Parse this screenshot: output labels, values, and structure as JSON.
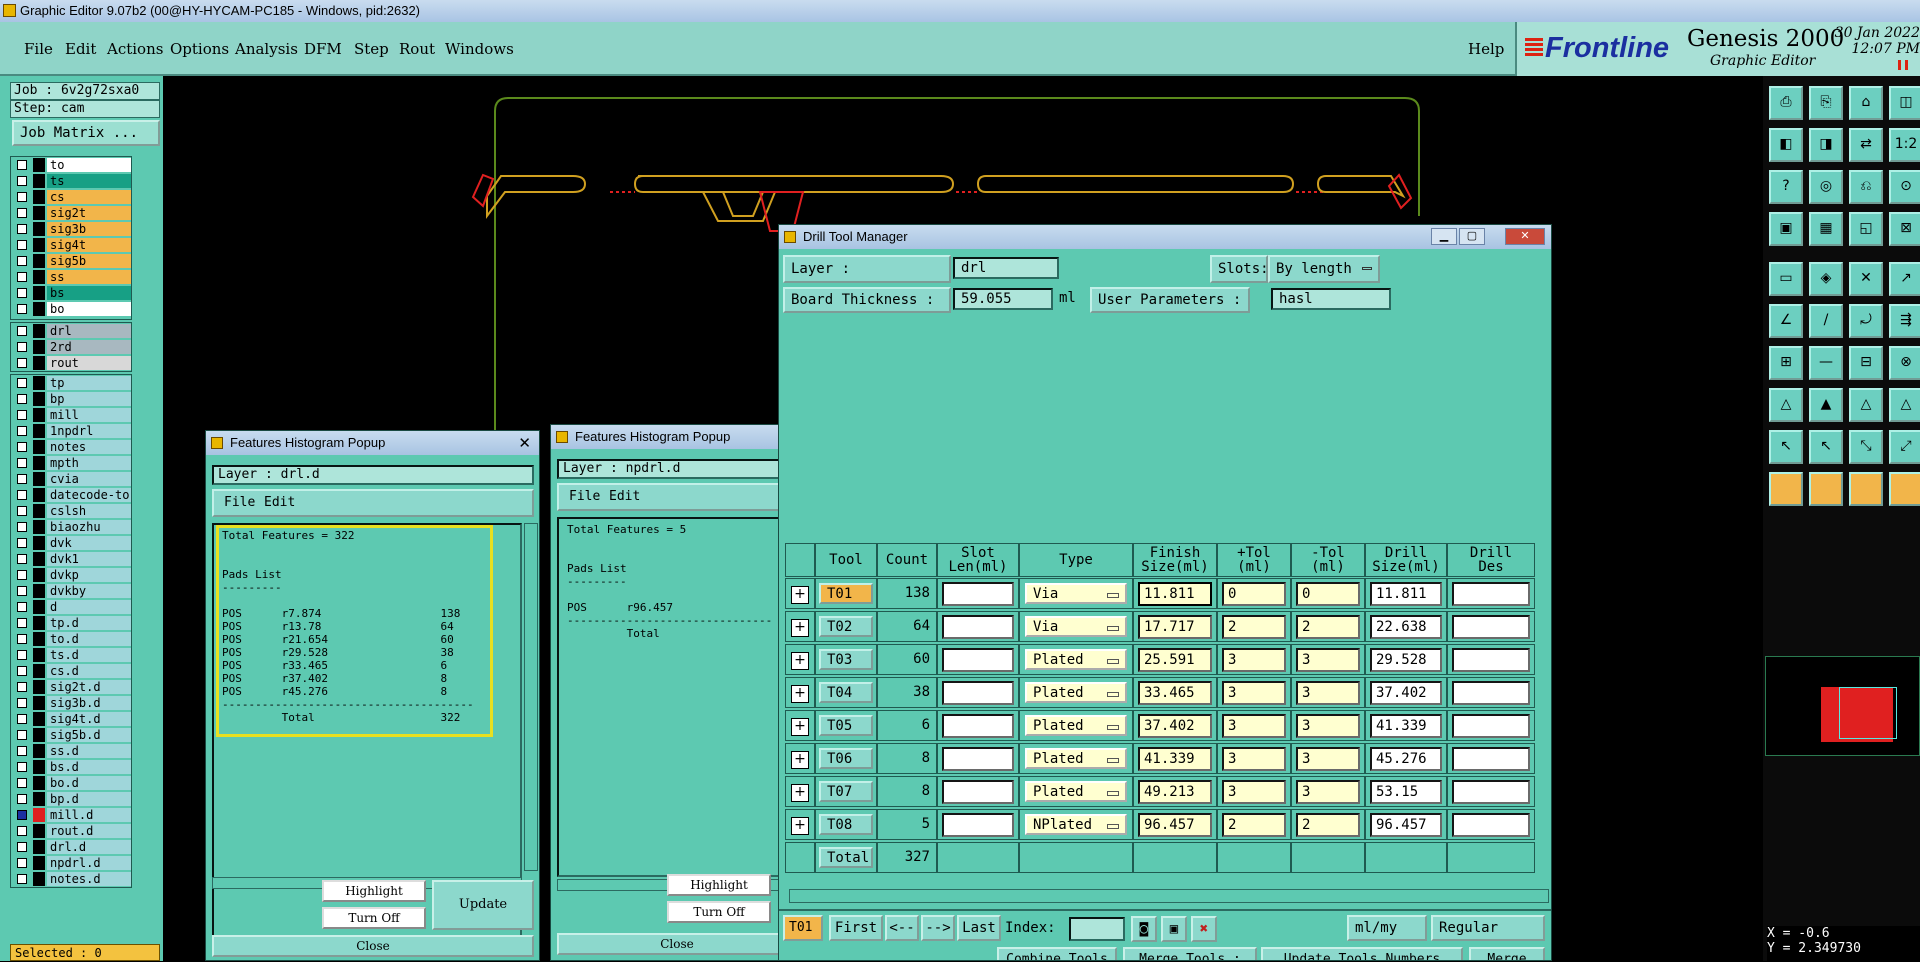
{
  "app": {
    "title": "Graphic Editor 9.07b2 (00@HY-HYCAM-PC185 - Windows, pid:2632)"
  },
  "menu": {
    "items": [
      "File",
      "Edit",
      "Actions",
      "Options",
      "Analysis",
      "DFM",
      "Step",
      "Rout",
      "Windows"
    ],
    "help": "Help"
  },
  "brand": {
    "logo": "Frontline",
    "product": "Genesis 2000",
    "subtitle": "Graphic Editor",
    "date": "30 Jan 2022",
    "time": "12:07 PM"
  },
  "left": {
    "job": "Job : 6v2g72sxa0",
    "step": "Step: cam",
    "job_matrix": "Job Matrix ...",
    "selected": "Selected : 0",
    "layers_a": [
      {
        "name": "to",
        "color": "#ffffff"
      },
      {
        "name": "ts",
        "color": "#17a085"
      },
      {
        "name": "cs",
        "color": "#f2b54a"
      },
      {
        "name": "sig2t",
        "color": "#f2b54a"
      },
      {
        "name": "sig3b",
        "color": "#f2b54a"
      },
      {
        "name": "sig4t",
        "color": "#f2b54a"
      },
      {
        "name": "sig5b",
        "color": "#f2b54a"
      },
      {
        "name": "ss",
        "color": "#f2b54a"
      },
      {
        "name": "bs",
        "color": "#17a085"
      },
      {
        "name": "bo",
        "color": "#ffffff"
      }
    ],
    "layers_b": [
      {
        "name": "drl",
        "color": "#a8b8c0"
      },
      {
        "name": "2rd",
        "color": "#a8b8c0"
      },
      {
        "name": "rout",
        "color": "#d8d8d8"
      }
    ],
    "layers_c": [
      {
        "name": "tp",
        "color": "#9fd6da"
      },
      {
        "name": "bp",
        "color": "#9fd6da"
      },
      {
        "name": "mill",
        "color": "#9fd6da"
      },
      {
        "name": "1npdrl",
        "color": "#9fd6da"
      },
      {
        "name": "notes",
        "color": "#9fd6da"
      },
      {
        "name": "mpth",
        "color": "#9fd6da"
      },
      {
        "name": "cvia",
        "color": "#9fd6da"
      },
      {
        "name": "datecode-to",
        "color": "#9fd6da"
      },
      {
        "name": "cslsh",
        "color": "#9fd6da"
      },
      {
        "name": "biaozhu",
        "color": "#9fd6da"
      },
      {
        "name": "dvk",
        "color": "#9fd6da"
      },
      {
        "name": "dvk1",
        "color": "#9fd6da"
      },
      {
        "name": "dvkp",
        "color": "#9fd6da"
      },
      {
        "name": "dvkby",
        "color": "#9fd6da"
      },
      {
        "name": "d",
        "color": "#9fd6da"
      },
      {
        "name": "tp.d",
        "color": "#9fd6da"
      },
      {
        "name": "to.d",
        "color": "#9fd6da"
      },
      {
        "name": "ts.d",
        "color": "#9fd6da"
      },
      {
        "name": "cs.d",
        "color": "#9fd6da"
      },
      {
        "name": "sig2t.d",
        "color": "#9fd6da"
      },
      {
        "name": "sig3b.d",
        "color": "#9fd6da"
      },
      {
        "name": "sig4t.d",
        "color": "#9fd6da"
      },
      {
        "name": "sig5b.d",
        "color": "#9fd6da"
      },
      {
        "name": "ss.d",
        "color": "#9fd6da"
      },
      {
        "name": "bs.d",
        "color": "#9fd6da"
      },
      {
        "name": "bo.d",
        "color": "#9fd6da"
      },
      {
        "name": "bp.d",
        "color": "#9fd6da"
      },
      {
        "name": "mill.d",
        "color": "#9fd6da"
      },
      {
        "name": "rout.d",
        "color": "#9fd6da"
      },
      {
        "name": "drl.d",
        "color": "#9fd6da"
      },
      {
        "name": "npdrl.d",
        "color": "#9fd6da"
      },
      {
        "name": "notes.d",
        "color": "#9fd6da"
      }
    ]
  },
  "hist1": {
    "title": "Features Histogram Popup",
    "layer": "Layer :  drl.d",
    "menu": [
      "File",
      "Edit"
    ],
    "text": "Total Features = 322\n\n\nPads List\n---------\n\nPOS      r7.874                  138\nPOS      r13.78                  64\nPOS      r21.654                 60\nPOS      r29.528                 38\nPOS      r33.465                 6\nPOS      r37.402                 8\nPOS      r45.276                 8\n--------------------------------------\n         Total                   322",
    "highlight": "Highlight",
    "turn_off": "Turn Off",
    "update": "Update",
    "close": "Close"
  },
  "hist2": {
    "title": "Features Histogram Popup",
    "layer": "Layer :  npdrl.d",
    "menu": [
      "File",
      "Edit"
    ],
    "text": "Total Features = 5\n\n\nPads List\n---------\n\nPOS      r96.457\n-------------------------------\n         Total",
    "highlight": "Highlight",
    "turn_off": "Turn Off",
    "close": "Close"
  },
  "dtm": {
    "title": "Drill Tool Manager",
    "layer_label": "Layer          :",
    "layer": "drl",
    "slots_label": "Slots:",
    "slots": "By length",
    "thickness_label": "Board Thickness :",
    "thickness": "59.055",
    "thickness_unit": "ml",
    "user_params_label": "User Parameters :",
    "user_params": "hasl",
    "headers": [
      "Tool",
      "Count",
      "Slot\nLen(ml)",
      "Type",
      "Finish\nSize(ml)",
      "+Tol\n(ml)",
      "-Tol\n(ml)",
      "Drill\nSize(ml)",
      "Drill\nDes"
    ],
    "rows": [
      {
        "tool": "T01",
        "count": "138",
        "type": "Via",
        "finish": "11.811",
        "ptol": "0",
        "mtol": "0",
        "drill": "11.811"
      },
      {
        "tool": "T02",
        "count": "64",
        "type": "Via",
        "finish": "17.717",
        "ptol": "2",
        "mtol": "2",
        "drill": "22.638"
      },
      {
        "tool": "T03",
        "count": "60",
        "type": "Plated",
        "finish": "25.591",
        "ptol": "3",
        "mtol": "3",
        "drill": "29.528"
      },
      {
        "tool": "T04",
        "count": "38",
        "type": "Plated",
        "finish": "33.465",
        "ptol": "3",
        "mtol": "3",
        "drill": "37.402"
      },
      {
        "tool": "T05",
        "count": "6",
        "type": "Plated",
        "finish": "37.402",
        "ptol": "3",
        "mtol": "3",
        "drill": "41.339"
      },
      {
        "tool": "T06",
        "count": "8",
        "type": "Plated",
        "finish": "41.339",
        "ptol": "3",
        "mtol": "3",
        "drill": "45.276"
      },
      {
        "tool": "T07",
        "count": "8",
        "type": "Plated",
        "finish": "49.213",
        "ptol": "3",
        "mtol": "3",
        "drill": "53.15"
      },
      {
        "tool": "T08",
        "count": "5",
        "type": "NPlated",
        "finish": "96.457",
        "ptol": "2",
        "mtol": "2",
        "drill": "96.457"
      }
    ],
    "total_label": "Total",
    "total": "327",
    "current_tool": "T01",
    "first": "First",
    "prev": "<--",
    "next": "-->",
    "last": "Last",
    "index_label": "Index:",
    "units": "ml/my",
    "mode": "Regular",
    "bottom_buttons": [
      "Combine Tools",
      "Merge Tools :",
      "Update Tools Numbers",
      "Merge"
    ]
  },
  "coords": {
    "x": "X = -0.6",
    "y": "Y = 2.349730"
  },
  "colors": {
    "panel": "#5dc9b1",
    "accent": "#f2b54a",
    "brand": "#1b2fa0"
  }
}
